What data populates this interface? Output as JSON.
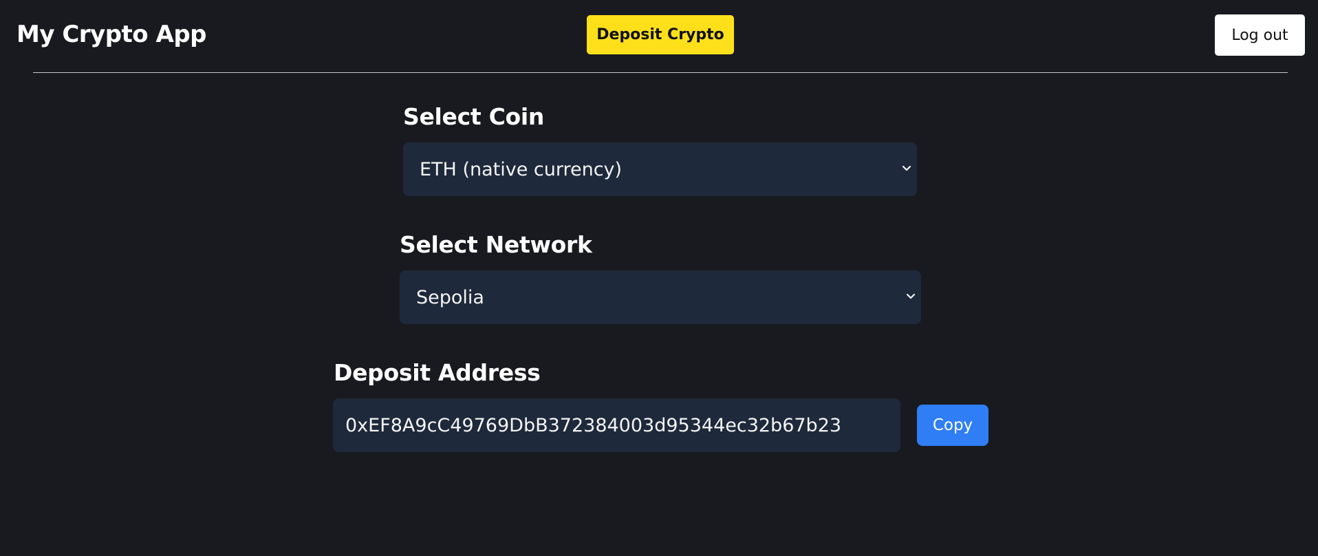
{
  "header": {
    "app_title": "My Crypto App",
    "deposit_label": "Deposit Crypto",
    "logout_label": "Log out"
  },
  "coin": {
    "label": "Select Coin",
    "selected": "ETH (native currency)"
  },
  "network": {
    "label": "Select Network",
    "selected": "Sepolia"
  },
  "deposit_address": {
    "label": "Deposit Address",
    "value": "0xEF8A9cC49769DbB372384003d95344ec32b67b23",
    "copy_label": "Copy"
  },
  "colors": {
    "background": "#191a20",
    "accent_yellow": "#fde01a",
    "field_background": "#1e293b",
    "copy_blue": "#2f7ef5"
  },
  "icons": [
    "chevron-down-icon"
  ]
}
